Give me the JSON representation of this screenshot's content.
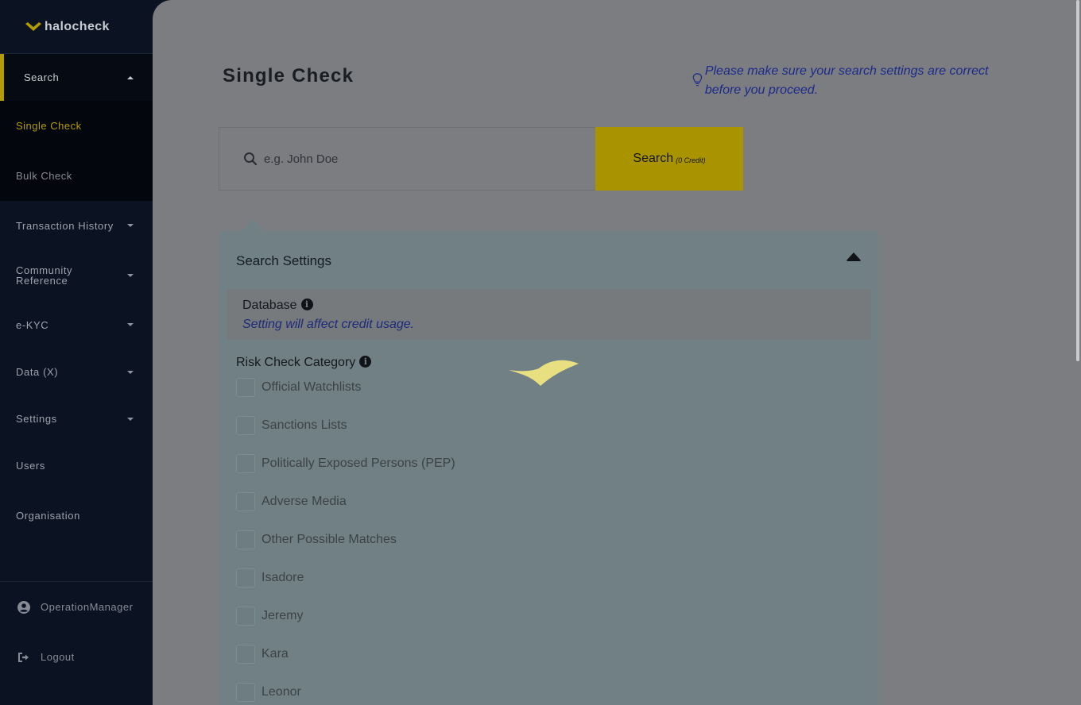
{
  "app": {
    "brand": "halocheck",
    "brand_color": "#b39c00"
  },
  "sidebar": {
    "search_group": {
      "label": "Search",
      "items": [
        {
          "label": "Single Check",
          "active": true
        },
        {
          "label": "Bulk Check",
          "active": false
        }
      ]
    },
    "items": [
      {
        "label": "Transaction History",
        "has_caret": true
      },
      {
        "label": "Community Reference",
        "has_caret": true
      },
      {
        "label": "e-KYC",
        "has_caret": true
      },
      {
        "label": "Data (X)",
        "has_caret": true
      },
      {
        "label": "Settings",
        "has_caret": true
      },
      {
        "label": "Users",
        "has_caret": false
      },
      {
        "label": "Organisation",
        "has_caret": false
      }
    ],
    "footer": {
      "user": "OperationManager",
      "user_icon": "user-circle-icon",
      "logout": "Logout",
      "logout_icon": "sign-out-icon"
    }
  },
  "main": {
    "title": "Single Check",
    "tip": "Please make sure your search settings are correct before you proceed.",
    "tip_icon": "lightbulb-icon",
    "search": {
      "placeholder": "e.g. John Doe",
      "button_label": "Search",
      "button_credit": "(0 Credit)"
    },
    "settings": {
      "title": "Search Settings",
      "database_label": "Database",
      "database_note": "Setting will affect credit usage.",
      "risk_label": "Risk Check Category",
      "categories": [
        "Official Watchlists",
        "Sanctions Lists",
        "Politically Exposed Persons (PEP)",
        "Adverse Media",
        "Other Possible Matches",
        "Isadore",
        "Jeremy",
        "Kara",
        "Leonor"
      ]
    }
  }
}
